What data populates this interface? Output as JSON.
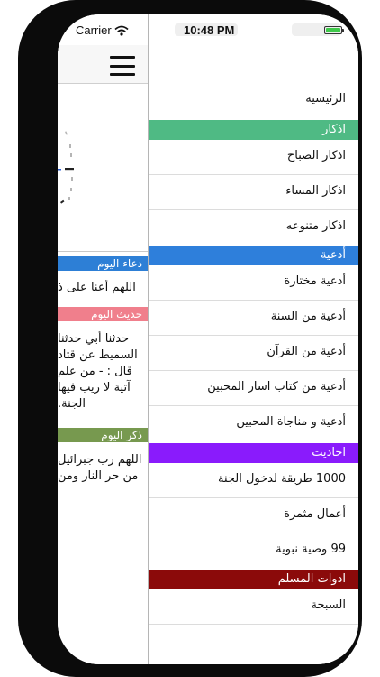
{
  "status_bar": {
    "carrier": "Carrier",
    "time": "10:48 PM",
    "battery_color": "#3fc94a"
  },
  "main_pane": {
    "menu_icon": "hamburger-icon",
    "sections": [
      {
        "header": "دعاء اليوم",
        "color": "#2d7fd6",
        "lines": [
          "اللهم أعنا على ذ"
        ]
      },
      {
        "header": "حديث اليوم",
        "color": "#f07f8c",
        "lines": [
          "حدثنا أبي حدثنا",
          "السميط عن قتاد",
          "قال : - من علم",
          "آتية لا ريب فيها",
          "الجنة."
        ]
      },
      {
        "header": "ذكر اليوم",
        "color": "#77994f",
        "lines": [
          "اللهم رب جبرائيل",
          "من حر النار ومن"
        ]
      }
    ]
  },
  "menu": {
    "home": "الرئيسيه",
    "sections": [
      {
        "header": "اذكار",
        "color": "#4fba84",
        "items": [
          "اذكار الصباح",
          "اذكار المساء",
          "اذكار متنوعه"
        ]
      },
      {
        "header": "أدعية",
        "color": "#2e7fdb",
        "items": [
          "أدعية مختارة",
          "أدعية من السنة",
          "أدعية من القرآن",
          "أدعية من كتاب اسار المحبين",
          "أدعية و مناجاة المحبين"
        ]
      },
      {
        "header": "احاديث",
        "color": "#8a1bfc",
        "items": [
          "1000 طريقة لدخول الجنة",
          "أعمال مثمرة",
          "99 وصية نبوية"
        ]
      },
      {
        "header": "ادوات المسلم",
        "color": "#8b0a0a",
        "items": [
          "السبحة"
        ]
      }
    ]
  }
}
